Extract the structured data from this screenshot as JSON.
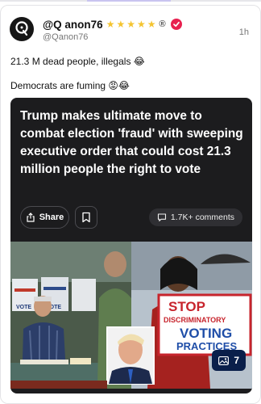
{
  "post": {
    "author_name": "@Q anon76",
    "badges": {
      "star_count": 5,
      "registered": "®",
      "verified_color": "#e8204f"
    },
    "handle": "@Qanon76",
    "time": "1h",
    "text_line_1": "21.3 M dead people, illegals 😂",
    "text_line_2": "Democrats are fuming 😡😂"
  },
  "embed": {
    "headline": "Trump makes ultimate move to combat election 'fraud' with sweeping executive order that could cost 21.3 million people the right to vote",
    "share_label": "Share",
    "comments_label": "1.7K+ comments",
    "image": {
      "left_sign": "VOTE",
      "protest_sign": {
        "line1": "STOP",
        "line2": "DISCRIMINATORY",
        "line3": "VOTING",
        "line4": "PRACTICES"
      }
    },
    "gallery_count": "7"
  },
  "colors": {
    "background": "#ffffff",
    "card_dark": "#1c1c1e",
    "star": "#f4c430",
    "gallery_badge": "#0a1f4a"
  }
}
